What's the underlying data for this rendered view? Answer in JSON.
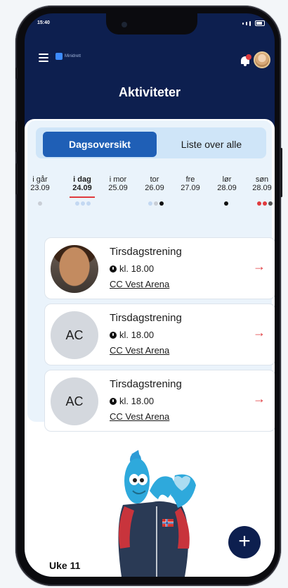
{
  "status_bar": {
    "time": "15:40"
  },
  "header": {
    "logo_text": "Minidrett",
    "notification_count": "1",
    "title": "Aktiviteter"
  },
  "toggle": {
    "active_label": "Dagsoversikt",
    "inactive_label": "Liste over alle"
  },
  "days": [
    {
      "label": "i går",
      "date": "23.09"
    },
    {
      "label": "i dag",
      "date": "24.09"
    },
    {
      "label": "i mor",
      "date": "25.09"
    },
    {
      "label": "tor",
      "date": "26.09"
    },
    {
      "label": "fre",
      "date": "27.09"
    },
    {
      "label": "lør",
      "date": "28.09"
    },
    {
      "label": "søn",
      "date": "28.09"
    }
  ],
  "activities": [
    {
      "title": "Tirsdagstrening",
      "time": "kl. 18.00",
      "location": "CC Vest Arena",
      "avatar": "photo"
    },
    {
      "title": "Tirsdagstrening",
      "time": "kl. 18.00",
      "location": "CC Vest Arena",
      "avatar": "AC"
    },
    {
      "title": "Tirsdagstrening",
      "time": "kl. 18.00",
      "location": "CC Vest Arena",
      "avatar": "AC"
    }
  ],
  "footer": {
    "week_label": "Uke 11",
    "fab": "+"
  },
  "colors": {
    "navy": "#0d1f4f",
    "accent_blue": "#1f5fb6",
    "red": "#e03a3e",
    "panel": "#eaf3fb"
  },
  "icons": {
    "menu": "hamburger-icon",
    "bell": "bell-icon",
    "clock": "clock-icon",
    "arrow": "arrow-right-icon",
    "add": "plus-icon"
  }
}
